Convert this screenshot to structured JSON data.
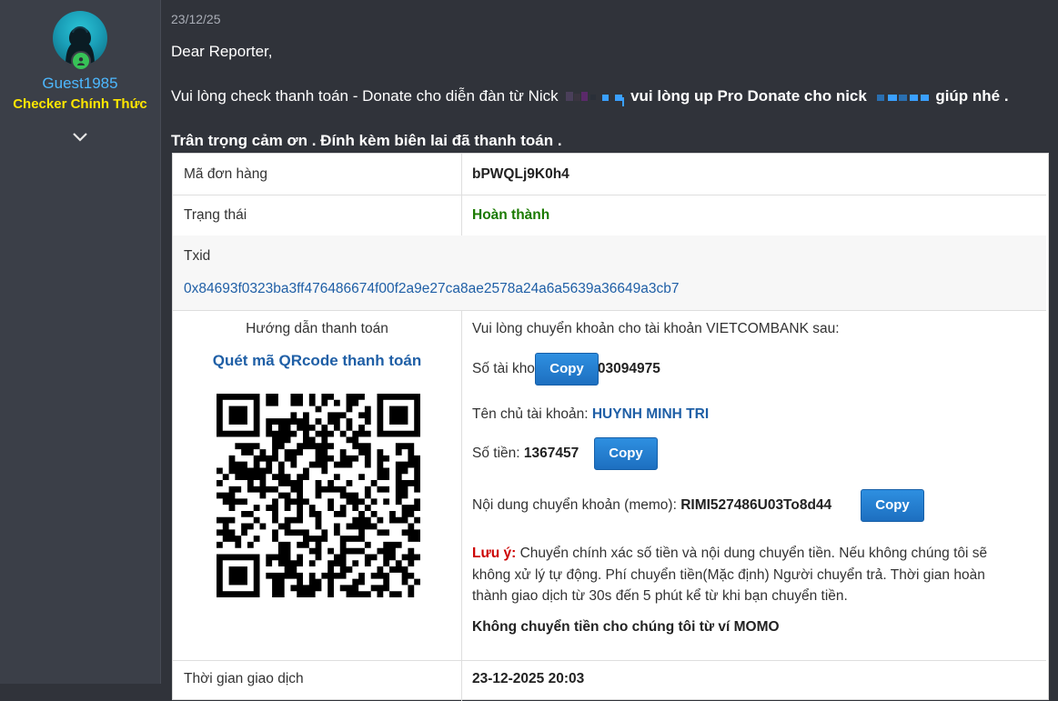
{
  "user": {
    "name": "Guest1985",
    "title": "Checker Chính Thức"
  },
  "post": {
    "date": "23/12/25",
    "greeting": "Dear Reporter,",
    "line1_part1": "Vui lòng check thanh toán - Donate cho diễn đàn từ Nick",
    "line1_part2": "vui lòng up Pro Donate cho nick",
    "line1_part3": "giúp nhé .",
    "line2": "Trân trọng cảm ơn . Đính kèm biên lai đã thanh toán ."
  },
  "payment": {
    "order_label": "Mã đơn hàng",
    "order_value": "bPWQLj9K0h4",
    "status_label": "Trạng thái",
    "status_value": "Hoàn thành",
    "txid_label": "Txid",
    "txid_value": "0x84693f0323ba3ff476486674f00f2a9e27ca8ae2578a24a6a5639a36649a3cb7",
    "guide_label": "Hướng dẫn thanh toán",
    "qr_label": "Quét mã QRcode thanh toán",
    "bank_intro": "Vui lòng chuyển khoản cho tài khoản VIETCOMBANK sau:",
    "account_label": "Số tài khoản:",
    "account_value": "0181003094975",
    "owner_label": "Tên chủ tài khoản:",
    "owner_value": "HUYNH MINH TRI",
    "amount_label": "Số tiền:",
    "amount_value": "1367457",
    "memo_label": "Nội dung chuyển khoản (memo):",
    "memo_value": "RIMI527486U03To8d44",
    "copy_label": "Copy",
    "note_label": "Lưu ý:",
    "note_text1": "Chuyển chính xác số tiền và nội dung chuyển tiền. Nếu không chúng tôi sẽ",
    "note_text2": "không xử lý tự động. Phí chuyển tiền(Mặc định) Người chuyển trả. Thời gian hoàn",
    "note_text3": "thành giao dịch từ 30s đến 5 phút kể từ khi bạn chuyển tiền.",
    "momo_warning": "Không chuyển tiền cho chúng tôi từ ví MOMO",
    "time_label": "Thời gian giao dịch",
    "time_value": "23-12-2025 20:03"
  },
  "colors": {
    "status_green": "#1a7a00",
    "accent_blue": "#1f5fa6",
    "note_red": "#cc0000",
    "title_yellow": "#ffe600",
    "username_blue": "#4db8ff"
  }
}
